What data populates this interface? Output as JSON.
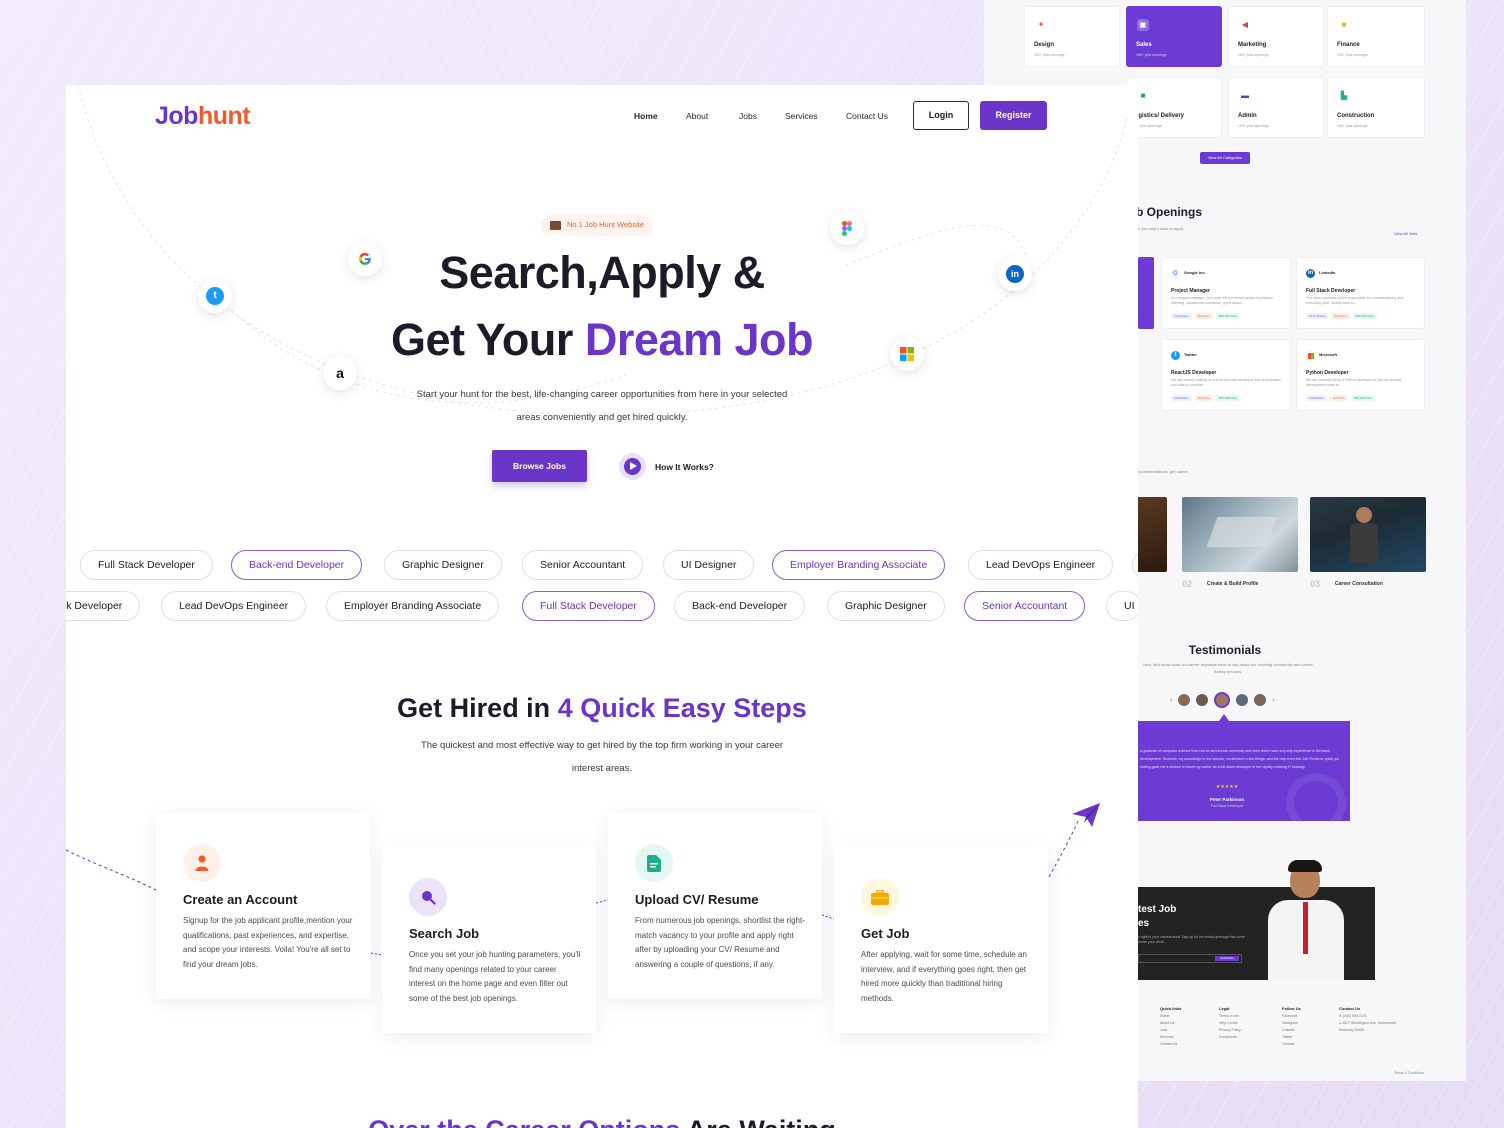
{
  "brand": {
    "logo_a": "Job",
    "logo_b": "hunt"
  },
  "nav": {
    "items": [
      "Home",
      "About",
      "Jobs",
      "Services",
      "Contact Us"
    ],
    "login": "Login",
    "register": "Register"
  },
  "hero": {
    "badge": "No.1 Job Hunt Website",
    "line1": "Search,Apply &",
    "line2_a": "Get Your ",
    "line2_b": "Dream Job",
    "subtitle": "Start your hunt for the best, life-changing career opportunities from here in your selected areas conveniently and get hired quickly.",
    "browse": "Browse Jobs",
    "how": "How It Works?"
  },
  "chips_row1": [
    "Full Stack Developer",
    "Back-end Developer",
    "Graphic Designer",
    "Senior Accountant",
    "UI Designer",
    "Employer Branding Associate",
    "Lead DevOps Engineer"
  ],
  "chips_row2": [
    "ck Developer",
    "Lead DevOps Engineer",
    "Employer Branding Associate",
    "Full Stack Developer",
    "Back-end Developer",
    "Graphic Designer",
    "Senior Accountant",
    "UI I"
  ],
  "steps": {
    "title_a": "Get Hired in ",
    "title_b": "4 Quick Easy Steps",
    "subtitle": "The quickest and most effective way to get hired by the top firm working in your career interest areas.",
    "cards": [
      {
        "title": "Create an Account",
        "desc": "Signup for the job applicant profile,mention your qualifications, past experiences, and expertise, and scope your interests. Voila! You're all set to find your dream jobs."
      },
      {
        "title": "Search Job",
        "desc": "Once you set your job hunting parameters, you'll find many openings related to your career interest on the home page and even filter out some of the best job openings."
      },
      {
        "title": "Upload CV/ Resume",
        "desc": "From numerous job openings, shortlist the right-match vacancy to your profile and apply right after by uploading your CV/ Resume and answering a couple of questions, if any."
      },
      {
        "title": "Get Job",
        "desc": "After applying, wait for some time, schedule an interview, and if everything goes right, then get hired more quickly than traditional hiring methods."
      }
    ]
  },
  "bottom_peek": {
    "a": "Over the ",
    "b": "Career Options",
    "c": " Are Waiting"
  },
  "back": {
    "categories": [
      {
        "name": "Design",
        "sub": "200+ jobs openings"
      },
      {
        "name": "Sales",
        "sub": "180+ jobs openings"
      },
      {
        "name": "Marketing",
        "sub": "160+ jobs openings"
      },
      {
        "name": "Finance",
        "sub": "200+ jobs openings"
      },
      {
        "name": "Logistics/ Delivery",
        "sub": "150+ jobs openings"
      },
      {
        "name": "Admin",
        "sub": "100+ jobs openings"
      },
      {
        "name": "Construction",
        "sub": "200+ jobs openings"
      }
    ],
    "view_all_categories": "View All Categories",
    "openings_title": "b Openings",
    "openings_sub": "ch you might want to apply",
    "view_all_jobs": "View All Jobs",
    "jobs": [
      {
        "company": "Google Inc.",
        "title": "Project Manager",
        "desc": "It's compact manager, your work will not remain areas of judicious planning, operational excellence, governance...",
        "t1": "2 Positions",
        "t2": "Full Time",
        "t3": "$20-30K/Year"
      },
      {
        "company": "LinkedIn",
        "title": "Full Stack Developer",
        "desc": "The ideal candidate will be responsible for conceptualizing and executing clear, quality code to...",
        "t1": "10 Positions",
        "t2": "Full Time",
        "t3": "$35-45K/Year"
      },
      {
        "company": "Twitter",
        "title": "ReactJS Developer",
        "desc": "We are actively looking for a front end web developer who is motivated and able to combine...",
        "t1": "4 Positions",
        "t2": "Full Time",
        "t3": "$35-45K/Year"
      },
      {
        "company": "Microsoft",
        "title": "Python Developer",
        "desc": "We are currently hiring a Python developer to join our product development team to...",
        "t1": "3 Positions",
        "t2": "Full Time",
        "t3": "$30-40K/Year"
      }
    ],
    "recommend_text": "recommendations, get career",
    "profile_num": "02",
    "profile_label": "Create & Build Profile",
    "consult_num": "03",
    "consult_label": "Career Consultation",
    "testimonials_title": "Testimonials",
    "testimonials_sub": "Now, let's know what our career aspirants have to say about our evolving community and career finding services.",
    "quote": "a graduate of computer science from not so well-known university and even didn't have any ship experience in full stack development. However, my knowledge in the domain, excitement n new things, and the help from this Job Portal for quick job finding gave me a chance to boost my career as a full-stack developer in the rapidly evolving IT industry.",
    "stars": "★★★★★",
    "person": "Peter Parkinson",
    "role": "Full Stack Developer",
    "news_title": "test Job",
    "news_title2": "es",
    "news_sub": "s right in your interest area! Sign up for the email openings that come under your circle.",
    "subscribe": "Subscribe",
    "footer": [
      {
        "h": "Quick links",
        "items": [
          "Home",
          "About Us",
          "Jobs",
          "Services",
          "Contact Us"
        ]
      },
      {
        "h": "Legal",
        "items": [
          "Terms of use",
          "Help Centre",
          "Privacy Policy",
          "Complaints"
        ]
      },
      {
        "h": "Follow Us",
        "items": [
          "Facebook",
          "Instagram",
          "LinkedIn",
          "Twitter",
          "Youtube"
        ]
      },
      {
        "h": "Contact Us",
        "items": [
          "(440) 555-0101",
          "4517 Washington Ave. Manchester, Kentucky 39495"
        ]
      }
    ],
    "terms": "Terms & Conditions"
  },
  "colors": {
    "brand": "#6b35c9",
    "accent": "#ef5b2c"
  },
  "icons": [
    "google-icon",
    "twitter-icon",
    "amazon-icon",
    "figma-icon",
    "linkedin-icon",
    "microsoft-icon",
    "user-icon",
    "search-icon",
    "document-icon",
    "briefcase-icon",
    "paper-plane-icon"
  ]
}
